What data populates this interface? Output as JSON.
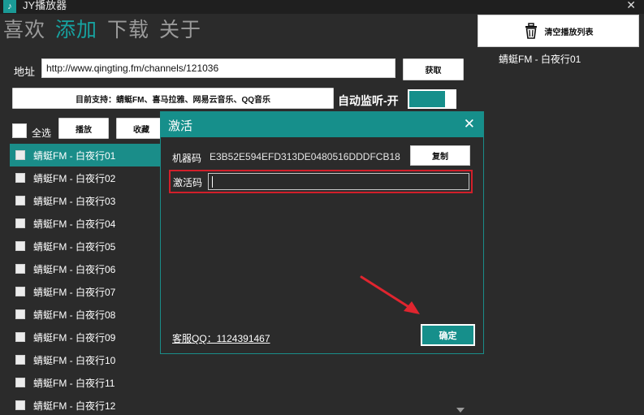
{
  "window": {
    "title": "JY播放器",
    "app_icon": "music-note-icon",
    "close_glyph": "✕"
  },
  "nav": {
    "tabs": [
      "喜欢",
      "添加",
      "下载",
      "关于"
    ],
    "active_index": 1
  },
  "address": {
    "label": "地址",
    "value": "http://www.qingting.fm/channels/121036",
    "fetch_label": "获取"
  },
  "support_banner": {
    "text": "目前支持：蜻蜓FM、喜马拉雅、网易云音乐、QQ音乐"
  },
  "auto_monitor": {
    "label": "自动监听-开",
    "on": true
  },
  "controls": {
    "select_all_label": "全选",
    "play_label": "播放",
    "favorite_label": "收藏"
  },
  "playlist": {
    "selected_index": 0,
    "items": [
      "蜻蜓FM - 白夜行01",
      "蜻蜓FM - 白夜行02",
      "蜻蜓FM - 白夜行03",
      "蜻蜓FM - 白夜行04",
      "蜻蜓FM - 白夜行05",
      "蜻蜓FM - 白夜行06",
      "蜻蜓FM - 白夜行07",
      "蜻蜓FM - 白夜行08",
      "蜻蜓FM - 白夜行09",
      "蜻蜓FM - 白夜行10",
      "蜻蜓FM - 白夜行11",
      "蜻蜓FM - 白夜行12"
    ]
  },
  "right_panel": {
    "clear_label": "清空播放列表",
    "clear_icon": "trash-icon",
    "now_playing": "蜻蜓FM - 白夜行01"
  },
  "dialog": {
    "title": "激活",
    "close_glyph": "✕",
    "machine_label": "机器码",
    "machine_code": "E3B52E594EFD313DE0480516DDDFCB18",
    "copy_label": "复制",
    "activation_label": "激活码",
    "activation_value": "",
    "support_text": "客服QQ：1124391467",
    "confirm_label": "确定"
  },
  "colors": {
    "accent": "#168f8b",
    "background": "#2b2b2b",
    "highlight_border": "#d21f2a",
    "arrow": "#e0252f"
  }
}
